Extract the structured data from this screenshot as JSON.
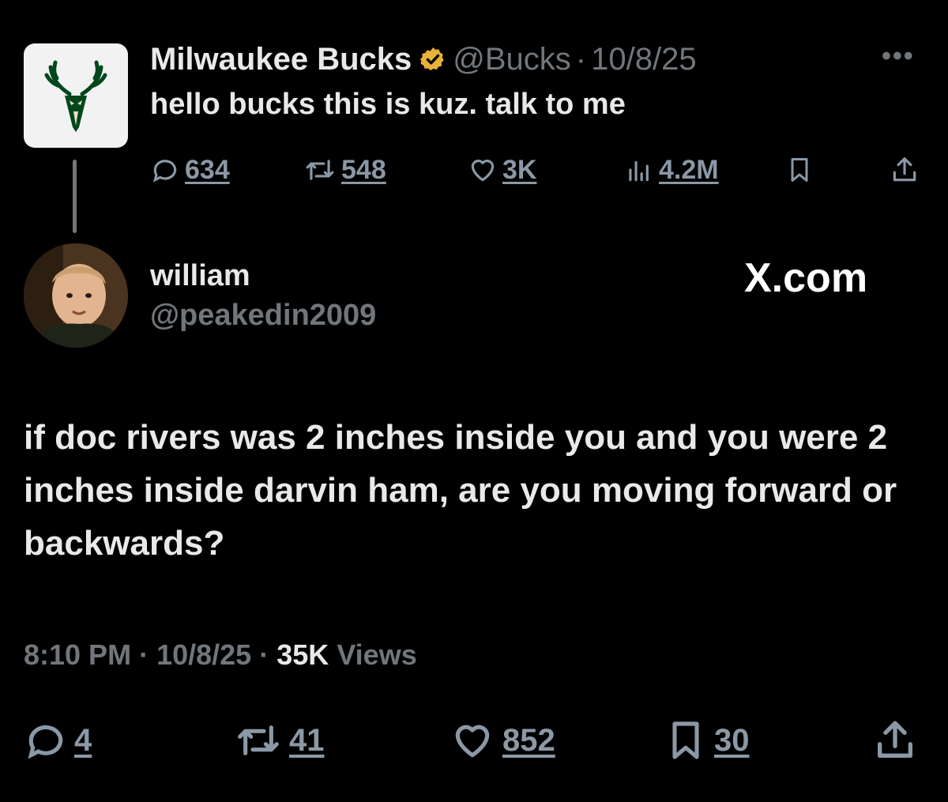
{
  "parent_tweet": {
    "author_name": "Milwaukee Bucks",
    "handle": "@Bucks",
    "separator": "·",
    "date": "10/8/25",
    "more": "•••",
    "text": "hello bucks this is kuz. talk to me",
    "stats": {
      "replies": "634",
      "reposts": "548",
      "likes": "3K",
      "views": "4.2M"
    }
  },
  "reply": {
    "author_name": "william",
    "handle": "@peakedin2009",
    "watermark": "X.com",
    "text": "if doc rivers was 2 inches inside you and you were 2 inches inside darvin ham, are you moving forward or backwards?",
    "time": "8:10 PM",
    "separator": "·",
    "date": "10/8/25",
    "views_count": "35K",
    "views_label": "Views",
    "stats": {
      "replies": "4",
      "reposts": "41",
      "likes": "852",
      "bookmarks": "30"
    }
  },
  "colors": {
    "background": "#000000",
    "text_primary": "#e7e9ea",
    "text_secondary": "#71767b",
    "verified_gold": "#e8b23a",
    "bucks_green": "#00471b"
  },
  "icons": [
    "reply-icon",
    "repost-icon",
    "like-icon",
    "views-icon",
    "bookmark-icon",
    "share-icon",
    "verified-badge-icon"
  ]
}
